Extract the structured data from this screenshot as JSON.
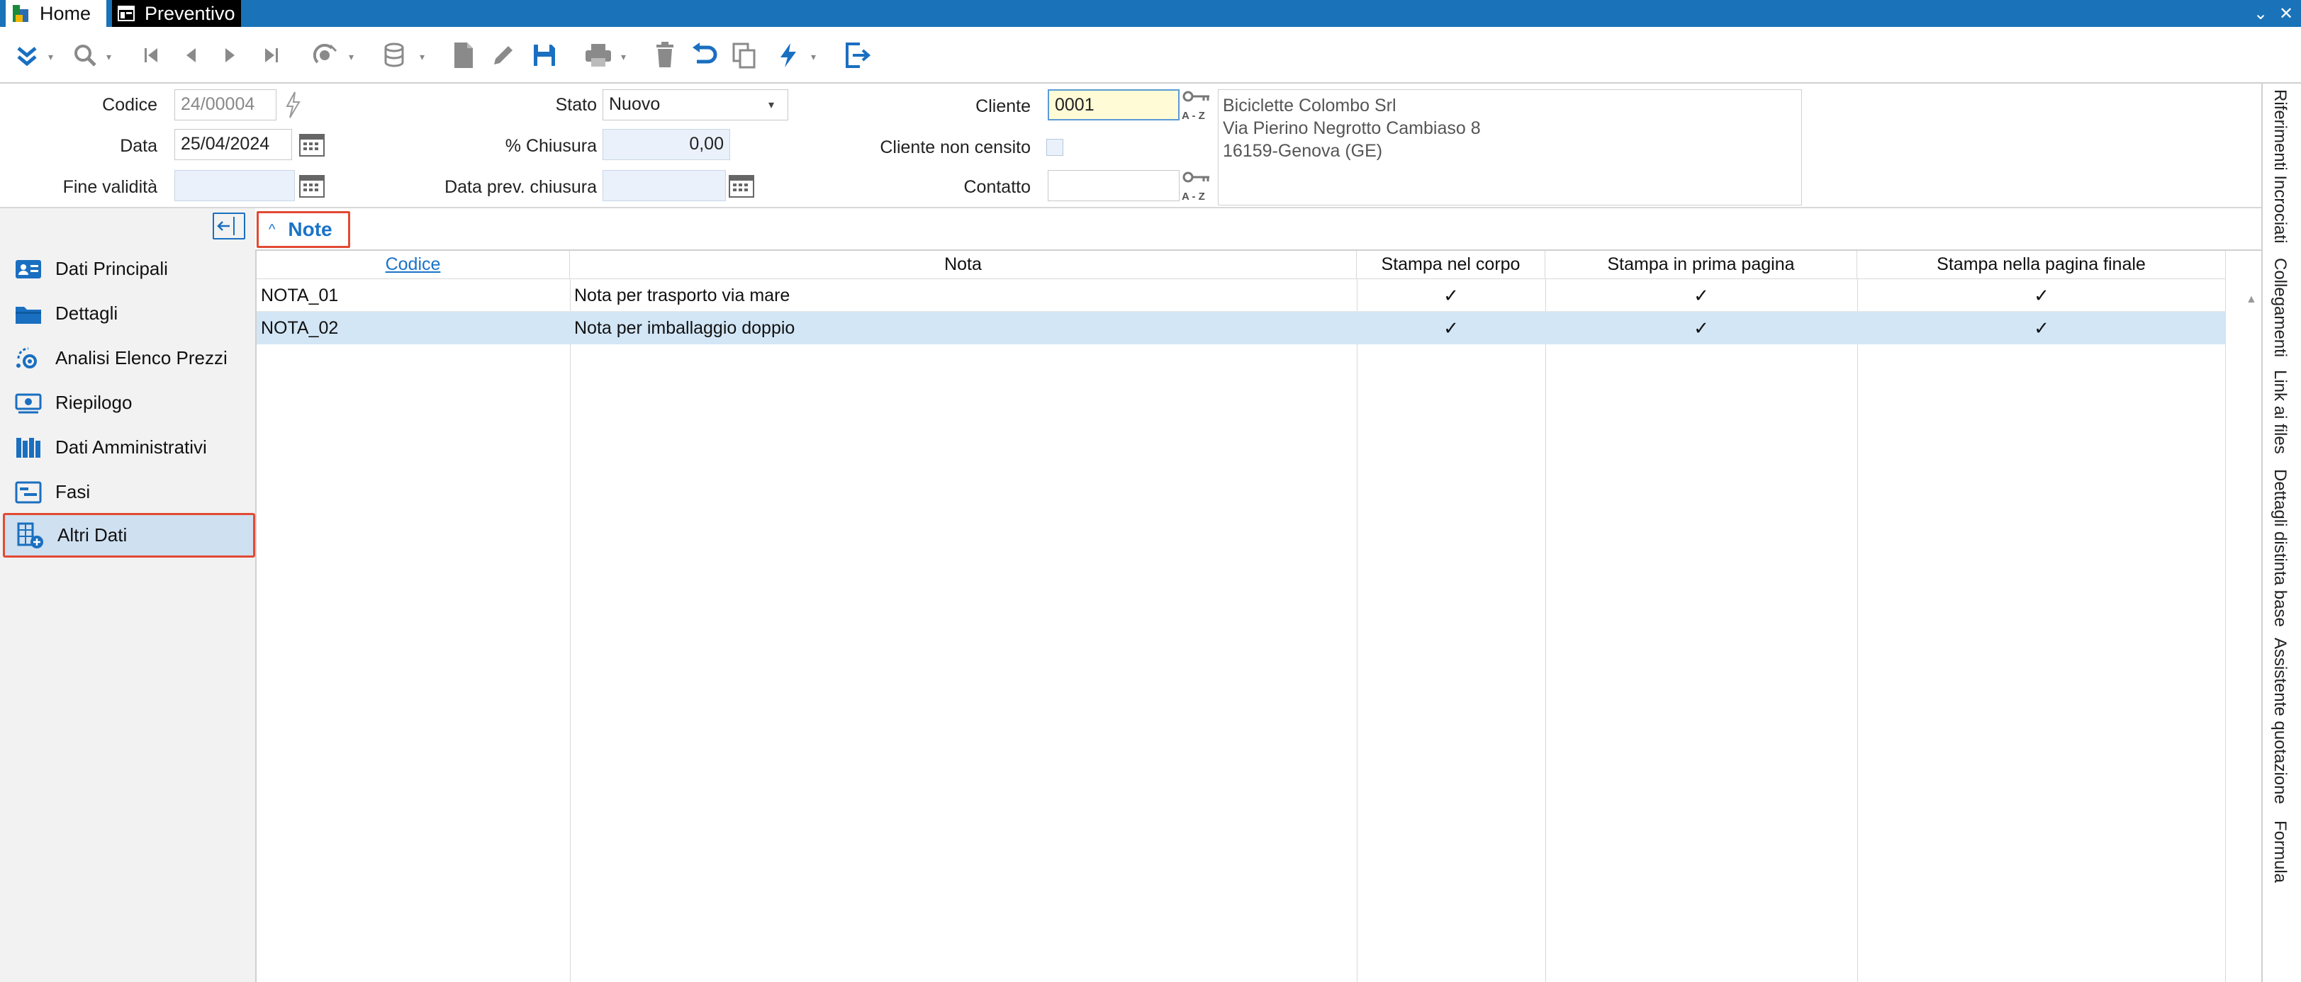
{
  "titlebar": {
    "tabs": [
      {
        "label": "Home"
      },
      {
        "label": "Preventivo"
      }
    ],
    "controls": {
      "minimize_icon": "chevron-down",
      "close_icon": "close"
    }
  },
  "toolbar": {
    "buttons": [
      "collapse-icon",
      "search-icon",
      "first-icon",
      "prev-icon",
      "next-icon",
      "last-icon",
      "satellite-icon",
      "database-icon",
      "new-document-icon",
      "edit-icon",
      "save-icon",
      "print-icon",
      "delete-icon",
      "undo-icon",
      "copy-icon",
      "lightning-icon",
      "exit-icon"
    ]
  },
  "form": {
    "codice": {
      "label": "Codice",
      "value": "24/00004"
    },
    "data": {
      "label": "Data",
      "value": "25/04/2024"
    },
    "fine_validita": {
      "label": "Fine validità",
      "value": ""
    },
    "stato": {
      "label": "Stato",
      "value": "Nuovo"
    },
    "chiusura": {
      "label": "% Chiusura",
      "value": "0,00"
    },
    "data_prev": {
      "label": "Data prev. chiusura",
      "value": ""
    },
    "cliente": {
      "label": "Cliente",
      "value": "0001"
    },
    "cliente_non_censito": {
      "label": "Cliente non censito",
      "checked": false
    },
    "contatto": {
      "label": "Contatto",
      "value": ""
    },
    "address": {
      "line1": "Biciclette Colombo Srl",
      "line2": "Via Pierino Negrotto Cambiaso 8",
      "line3": "16159-Genova (GE)"
    },
    "key_az_text": "A - Z"
  },
  "nav": {
    "items": [
      {
        "label": "Dati Principali",
        "icon": "id-card-icon"
      },
      {
        "label": "Dettagli",
        "icon": "folder-icon"
      },
      {
        "label": "Analisi Elenco Prezzi",
        "icon": "gear-cycle-icon"
      },
      {
        "label": "Riepilogo",
        "icon": "money-icon"
      },
      {
        "label": "Dati Amministrativi",
        "icon": "books-icon"
      },
      {
        "label": "Fasi",
        "icon": "phases-icon"
      },
      {
        "label": "Altri Dati",
        "icon": "table-plus-icon",
        "active": true
      }
    ]
  },
  "section": {
    "title": "Note"
  },
  "grid": {
    "columns": [
      "Codice",
      "Nota",
      "Stampa nel corpo",
      "Stampa in prima pagina",
      "Stampa nella pagina finale"
    ],
    "rows": [
      {
        "codice": "NOTA_01",
        "nota": "Nota per trasporto via mare",
        "corpo": "✓",
        "prima": "✓",
        "finale": "✓"
      },
      {
        "codice": "NOTA_02",
        "nota": "Nota per imballaggio doppio",
        "corpo": "✓",
        "prima": "✓",
        "finale": "✓"
      }
    ]
  },
  "right_tabs": [
    "Riferimenti Incrociati",
    "Collegamenti",
    "Link ai files",
    "Dettagli distinta base",
    "Assistente quotazione",
    "Formula"
  ],
  "colors": {
    "accent": "#1a73b8",
    "highlight_border": "#e24a33",
    "selected_row": "#d3e6f6",
    "input_yellow": "#fffbd6"
  }
}
